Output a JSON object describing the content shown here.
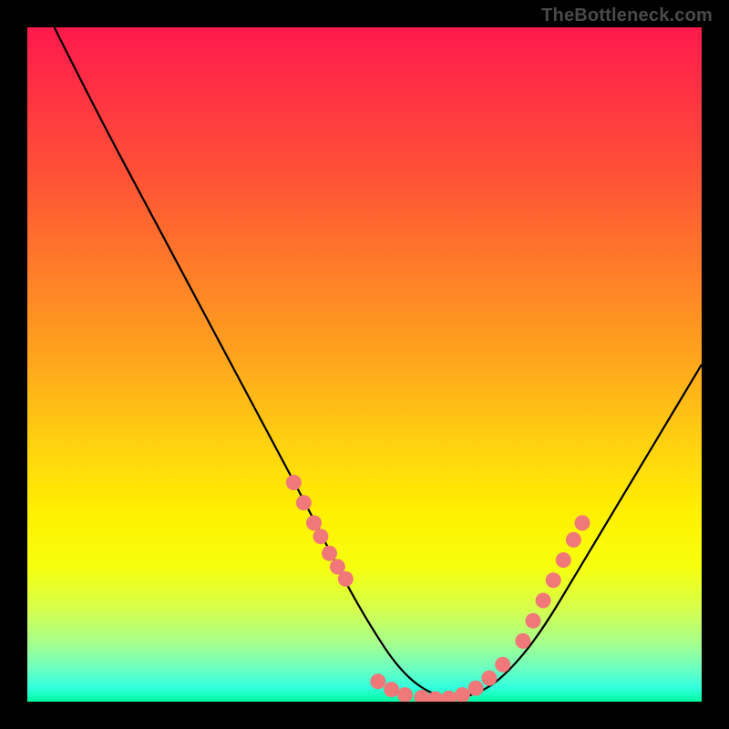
{
  "watermark": "TheBottleneck.com",
  "chart_data": {
    "type": "line",
    "title": "",
    "xlabel": "",
    "ylabel": "",
    "xlim": [
      0,
      100
    ],
    "ylim": [
      0,
      100
    ],
    "curve": {
      "x": [
        4,
        10,
        18,
        26,
        34,
        42,
        47,
        51,
        55,
        59,
        63,
        67,
        71,
        76,
        82,
        88,
        94,
        100
      ],
      "y": [
        100,
        88,
        73,
        58,
        43,
        28,
        18,
        11,
        5,
        1.5,
        0.4,
        1.2,
        4,
        10,
        20,
        30,
        40,
        50
      ]
    },
    "markers_left": {
      "comment": "salmon dots along left descending arm",
      "x": [
        39.5,
        41.0,
        42.5,
        43.5,
        44.8,
        46.0,
        47.2
      ],
      "y": [
        32.5,
        29.5,
        26.5,
        24.5,
        22.0,
        20.0,
        18.2
      ]
    },
    "markers_right": {
      "comment": "salmon dots along right ascending arm",
      "x": [
        73.5,
        75.0,
        76.5,
        78.0,
        79.5,
        81.0,
        82.3
      ],
      "y": [
        9.0,
        12.0,
        15.0,
        18.0,
        21.0,
        24.0,
        26.5
      ]
    },
    "markers_bottom": {
      "comment": "salmon dots along trough",
      "x": [
        52.0,
        54.0,
        56.0,
        58.5,
        60.5,
        62.5,
        64.5,
        66.5,
        68.5,
        70.5
      ],
      "y": [
        3.0,
        1.8,
        1.0,
        0.6,
        0.4,
        0.5,
        1.0,
        2.0,
        3.5,
        5.5
      ]
    },
    "colors": {
      "curve": "#000000",
      "markers": "#f07878"
    }
  }
}
